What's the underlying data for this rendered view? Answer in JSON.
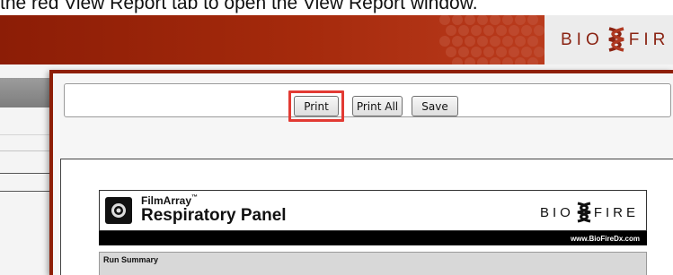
{
  "instruction": "the red View Report tab to open the View Report window.",
  "brand": {
    "logo_left": "BIO",
    "logo_right": "FIR"
  },
  "toolbar": {
    "print_label": "Print",
    "print_all_label": "Print All",
    "save_label": "Save"
  },
  "report": {
    "product": "FilmArray",
    "trademark": "™",
    "panel": "Respiratory Panel",
    "logo_left": "BIO",
    "logo_right": "FIRE",
    "website": "www.BioFireDx.com",
    "section_title": "Run Summary"
  },
  "colors": {
    "banner": "#a52a0c",
    "window_border": "#8e1f08",
    "highlight": "#e23a33"
  }
}
